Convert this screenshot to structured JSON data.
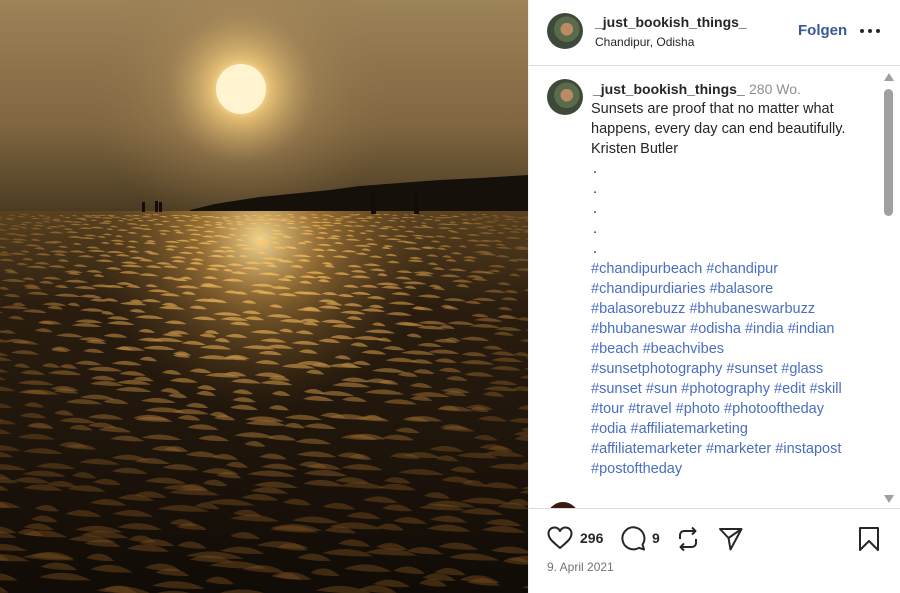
{
  "post": {
    "username": "_just_bookish_things_",
    "location": "Chandipur, Odisha",
    "follow_label": "Folgen",
    "more_icon": "more-horizontal-icon"
  },
  "caption": {
    "username": "_just_bookish_things_",
    "age": "280 Wo.",
    "lines": [
      "Sunsets are proof that no matter what",
      "happens, every day can end beautifully.",
      "Kristen Butler"
    ],
    "dots": [
      ".",
      ".",
      ".",
      ".",
      "."
    ],
    "hashtag_lines": [
      "#chandipurbeach #chandipur",
      "#chandipurdiaries #balasore",
      "#balasorebuzz #bhubaneswarbuzz",
      "#bhubaneswar #odisha #india #indian",
      "#beach #beachvibes",
      "#sunsetphotography #sunset #glass",
      "#sunset #sun #photography #edit #skill",
      "#tour #travel #photo #photooftheday",
      "#odia #affiliatemarketing",
      "#affiliatemarketer #marketer #instapost",
      "#postoftheday"
    ]
  },
  "actions": {
    "likes": "296",
    "comments": "9",
    "date": "9. April 2021"
  },
  "colors": {
    "accent": "#385898",
    "hashtag": "#4a6ec0",
    "muted": "#737373"
  }
}
